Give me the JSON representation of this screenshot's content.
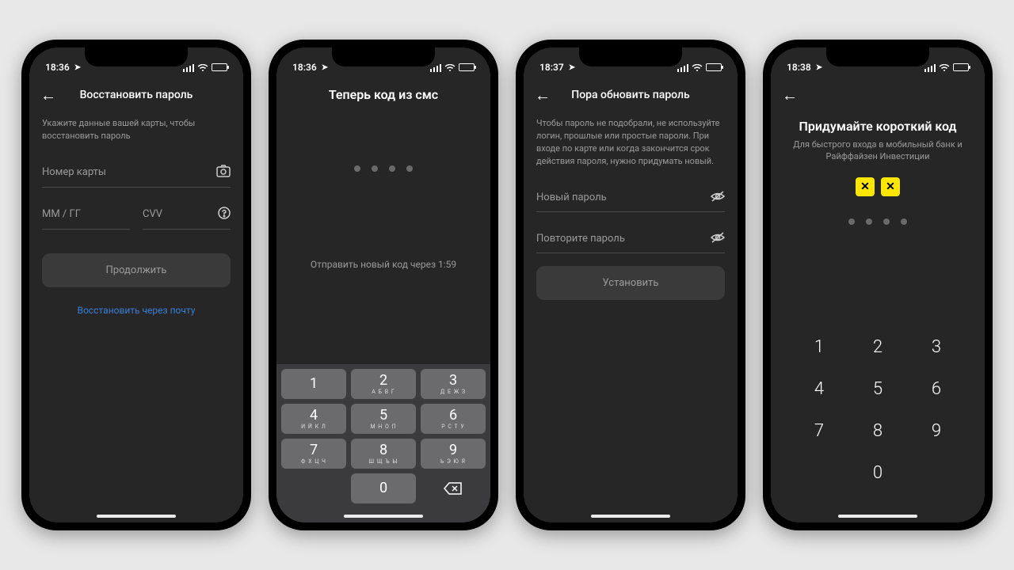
{
  "screens": [
    {
      "time": "18:36",
      "title": "Восстановить пароль",
      "hint": "Укажите данные вашей карты, чтобы восстановить пароль",
      "card_ph": "Номер карты",
      "exp_ph": "ММ / ГГ",
      "cvv_ph": "CVV",
      "btn": "Продолжить",
      "link": "Восстановить через почту"
    },
    {
      "time": "18:36",
      "title": "Теперь код из смс",
      "resend": "Отправить новый код через 1:59",
      "keys": [
        {
          "n": "1",
          "l": ""
        },
        {
          "n": "2",
          "l": "А Б В Г"
        },
        {
          "n": "3",
          "l": "Д Е Ж З"
        },
        {
          "n": "4",
          "l": "И Й К Л"
        },
        {
          "n": "5",
          "l": "М Н О П"
        },
        {
          "n": "6",
          "l": "Р С Т У"
        },
        {
          "n": "7",
          "l": "Ф Х Ц Ч"
        },
        {
          "n": "8",
          "l": "Ш Щ Ъ Ы"
        },
        {
          "n": "9",
          "l": "Ь Э Ю Я"
        }
      ],
      "zero": "0"
    },
    {
      "time": "18:37",
      "title": "Пора обновить пароль",
      "hint": "Чтобы пароль не подобрали, не используйте логин, прошлые или простые пароли. При входе по карте или когда закончится срок действия пароля, нужно придумать новый.",
      "newpw_ph": "Новый пароль",
      "reppw_ph": "Повторите пароль",
      "btn": "Установить"
    },
    {
      "time": "18:38",
      "title": "Придумайте короткий код",
      "sub": "Для быстрого входа в мобильный банк и Райффайзен Инвестиции",
      "keys_plain": [
        "1",
        "2",
        "3",
        "4",
        "5",
        "6",
        "7",
        "8",
        "9",
        "",
        "0",
        ""
      ]
    }
  ]
}
